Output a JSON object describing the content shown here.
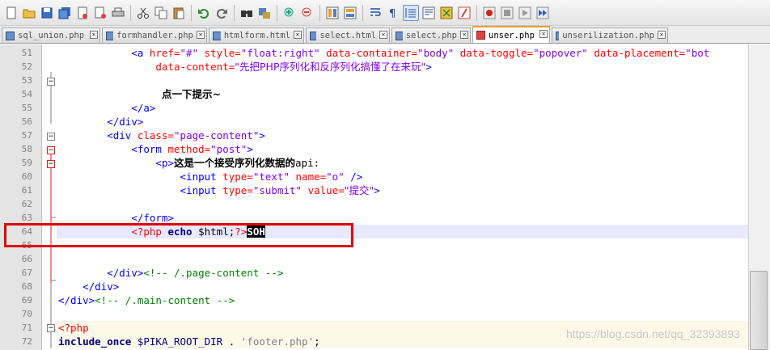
{
  "toolbar": {
    "icons": [
      "new-file",
      "open-file",
      "save",
      "save-all",
      "close",
      "close-all",
      "print",
      "cut",
      "copy",
      "paste",
      "undo",
      "redo",
      "find",
      "replace",
      "zoom-in",
      "zoom-out",
      "sync-v",
      "sync-h",
      "word-wrap",
      "show-all-chars",
      "indent-guide",
      "udl",
      "doc-map",
      "function-list",
      "record-macro",
      "stop-macro",
      "play-macro",
      "run-macro-multiple"
    ]
  },
  "tabs": [
    {
      "label": "sql_union.php",
      "active": false
    },
    {
      "label": "formhandler.php",
      "active": false
    },
    {
      "label": "htmlform.html",
      "active": false
    },
    {
      "label": "select.html",
      "active": false
    },
    {
      "label": "select.php",
      "active": false
    },
    {
      "label": "unser.php",
      "active": true
    },
    {
      "label": "unserilization.php",
      "active": false
    }
  ],
  "lines": {
    "l51": {
      "num": "51",
      "indent": "            ",
      "tag1": "<a ",
      "attr1": "href=",
      "val1": "\"#\"",
      "attr2": " style=",
      "val2": "\"float:right\"",
      "attr3": " data-container=",
      "val3": "\"body\"",
      "attr4": " data-toggle=",
      "val4": "\"popover\"",
      "attr5": " data-placement=",
      "val5": "\"bot"
    },
    "l52": {
      "num": "52",
      "indent": "                ",
      "attr1": "data-content=",
      "val1": "\"先把PHP序列化和反序列化搞懂了在来玩\"",
      "tag1": ">"
    },
    "l53": {
      "num": "53"
    },
    "l54": {
      "num": "54",
      "indent": "                 ",
      "text": "点一下提示~"
    },
    "l55": {
      "num": "55",
      "indent": "            ",
      "tag1": "</a>"
    },
    "l56": {
      "num": "56",
      "indent": "        ",
      "tag1": "</div>"
    },
    "l57": {
      "num": "57",
      "indent": "        ",
      "tag1": "<div ",
      "attr1": "class=",
      "val1": "\"page-content\"",
      "tag2": ">"
    },
    "l58": {
      "num": "58",
      "indent": "            ",
      "tag1": "<form ",
      "attr1": "method=",
      "val1": "\"post\"",
      "tag2": ">"
    },
    "l59": {
      "num": "59",
      "indent": "                ",
      "tag1": "<p>",
      "text": "这是一个接受序列化数据的",
      "text2": "api:"
    },
    "l60": {
      "num": "60",
      "indent": "                    ",
      "tag1": "<input ",
      "attr1": "type=",
      "val1": "\"text\"",
      "attr2": " name=",
      "val2": "\"o\"",
      "tag2": " />"
    },
    "l61": {
      "num": "61",
      "indent": "                    ",
      "tag1": "<input ",
      "attr1": "type=",
      "val1": "\"submit\"",
      "attr2": " value=",
      "val2": "\"提交\"",
      "tag2": ">"
    },
    "l62": {
      "num": "62"
    },
    "l63": {
      "num": "63",
      "indent": "            ",
      "tag1": "</form>"
    },
    "l64": {
      "num": "64",
      "indent": "            ",
      "php1": "<?php",
      "kw1": " echo",
      "var1": " $html;",
      "php2": "?>",
      "sel": "SOH"
    },
    "l65": {
      "num": "65"
    },
    "l66": {
      "num": "66"
    },
    "l67": {
      "num": "67",
      "indent": "        ",
      "tag1": "</div>",
      "cm1": "<!-- /.page-content -->"
    },
    "l68": {
      "num": "68",
      "indent": "    ",
      "tag1": "</div>"
    },
    "l69": {
      "num": "69",
      "tag1": "</div>",
      "cm1": "<!-- /.main-content -->"
    },
    "l70": {
      "num": "70"
    },
    "l71": {
      "num": "71",
      "php1": "<?php"
    },
    "l72": {
      "num": "72",
      "kw1": "include_once",
      "var1": " $PIKA_ROOT_DIR",
      "sp1": " . ",
      "val1": "'footer.php'",
      "sp2": ";"
    }
  },
  "watermark": "https://blog.csdn.net/qq_32393893",
  "colors": {
    "tag": "#0000ff",
    "attr": "#ff0000",
    "value": "#8000ff",
    "comment": "#008000",
    "php": "#ff0000",
    "keyword": "#000080",
    "highlight": "#e8e8ff",
    "annotation_box": "#e00000"
  }
}
